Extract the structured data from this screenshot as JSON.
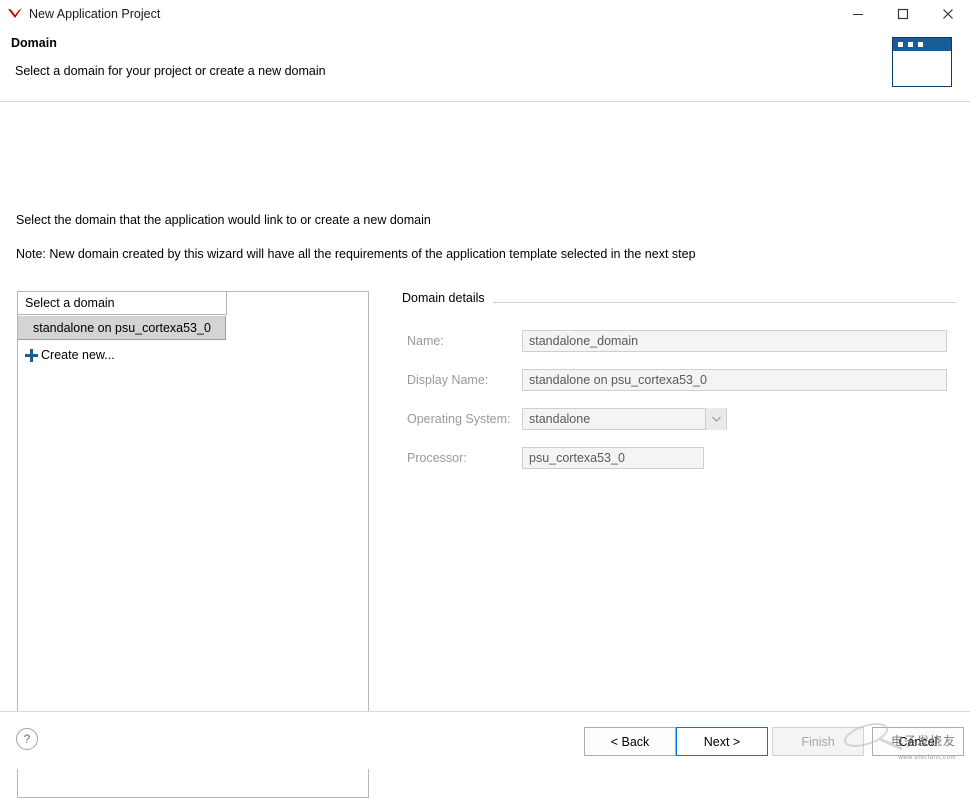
{
  "window": {
    "title": "New Application Project",
    "icon": "xilinx-logo-icon",
    "minimize_label": "–",
    "maximize_label": "□",
    "close_label": "✕"
  },
  "header": {
    "title": "Domain",
    "subtitle": "Select a domain for your project or create a new domain"
  },
  "instructions": {
    "line1": "Select the domain that the application would link to or create a new domain",
    "line2": "Note: New domain created by this wizard will have all the requirements of the application template selected in the next step"
  },
  "domain_list": {
    "header": "Select a domain",
    "items": [
      {
        "label": "standalone on psu_cortexa53_0",
        "selected": true
      }
    ],
    "create_new_label": "Create new...",
    "create_new_icon": "plus-icon"
  },
  "details": {
    "title": "Domain details",
    "fields": [
      {
        "label": "Name:",
        "value": "standalone_domain",
        "type": "text"
      },
      {
        "label": "Display Name:",
        "value": "standalone on psu_cortexa53_0",
        "type": "text"
      },
      {
        "label": "Operating System:",
        "value": "standalone",
        "type": "combo"
      },
      {
        "label": "Processor:",
        "value": "psu_cortexa53_0",
        "type": "text"
      }
    ]
  },
  "footer": {
    "help_icon": "question-mark-icon",
    "help_label": "?",
    "buttons": [
      {
        "name": "back",
        "label": "< Back",
        "enabled": true,
        "primary": false
      },
      {
        "name": "next",
        "label": "Next >",
        "enabled": true,
        "primary": true
      },
      {
        "name": "finish",
        "label": "Finish",
        "enabled": false,
        "primary": false
      },
      {
        "name": "cancel",
        "label": "Cancel",
        "enabled": true,
        "primary": false
      }
    ]
  },
  "watermark": {
    "text": "电子发烧友",
    "sub": "www.elecfans.com"
  }
}
